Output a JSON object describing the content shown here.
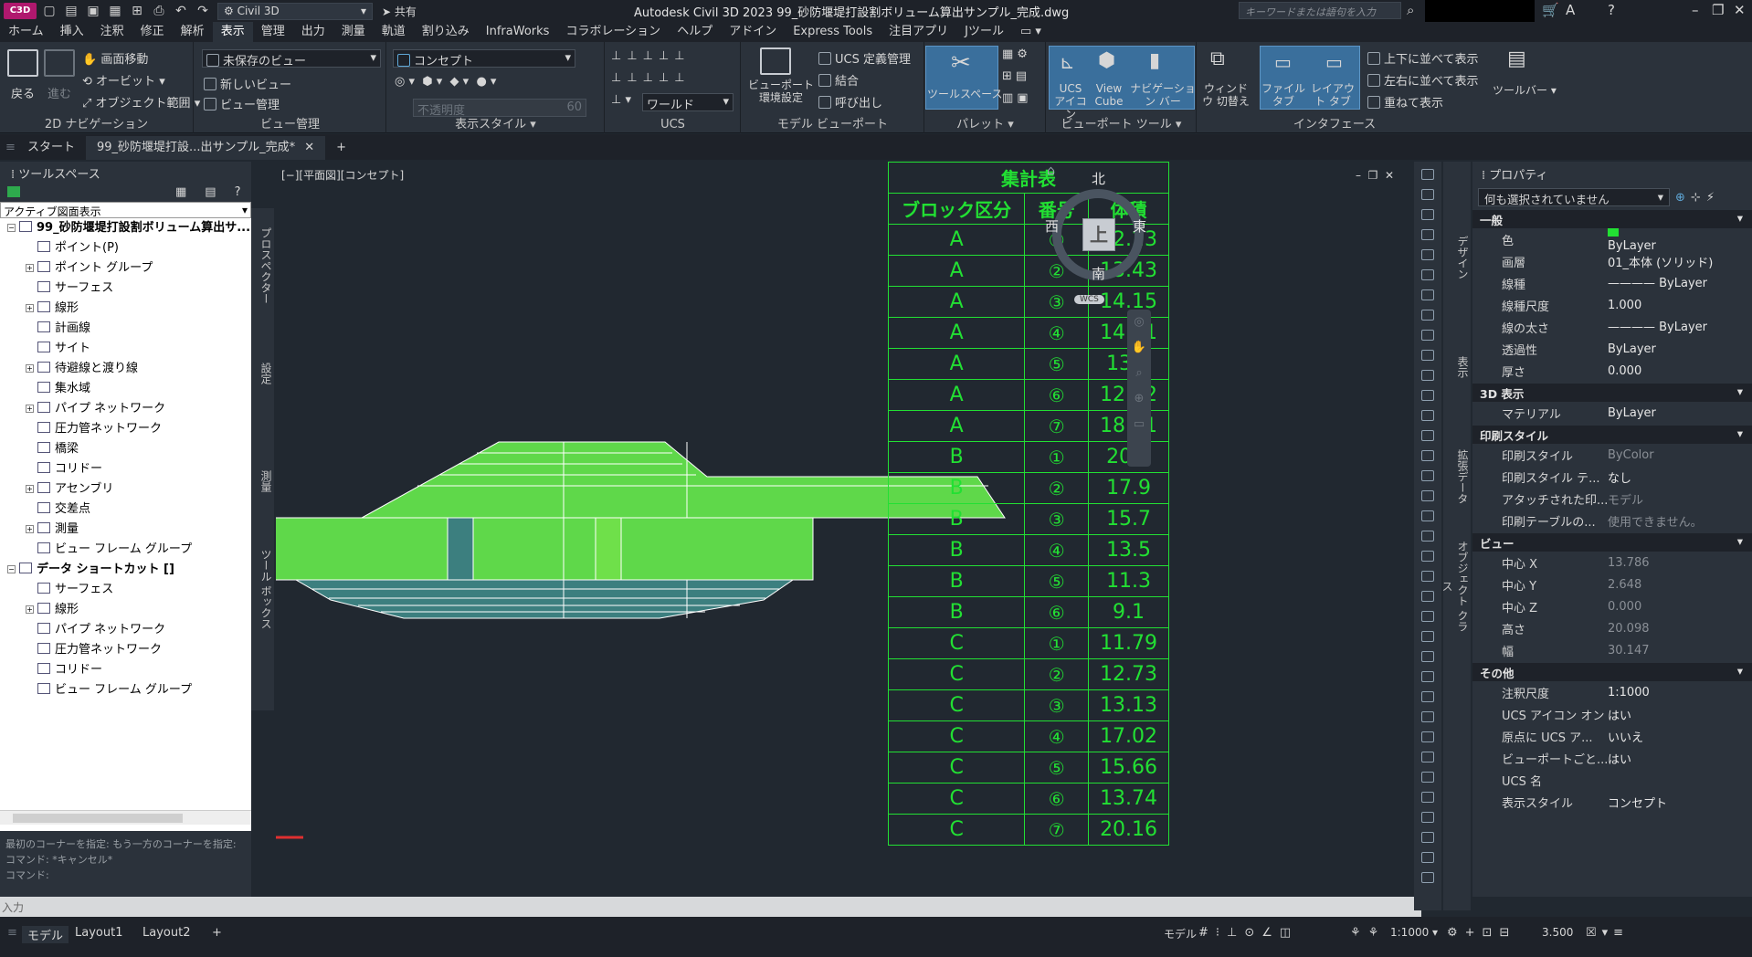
{
  "titlebar": {
    "logo": "C3D",
    "workspace": "Civil 3D",
    "share": "共有",
    "title": "Autodesk Civil 3D 2023    99_砂防堰堤打設割ボリューム算出サンプル_完成.dwg",
    "search_placeholder": "キーワードまたは語句を入力"
  },
  "menu": [
    "ホーム",
    "挿入",
    "注釈",
    "修正",
    "解析",
    "表示",
    "管理",
    "出力",
    "測量",
    "軌道",
    "割り込み",
    "InfraWorks",
    "コラボレーション",
    "ヘルプ",
    "アドイン",
    "Express Tools",
    "注目アプリ",
    "Jツール"
  ],
  "menu_active": "表示",
  "ribbon": {
    "nav2d": {
      "label": "2D ナビゲーション",
      "back": "戻る",
      "forward": "進む",
      "pan": "画面移動",
      "orbit": "オービット",
      "extents": "オブジェクト範囲"
    },
    "views": {
      "label": "ビュー管理",
      "unsaved": "未保存のビュー",
      "new": "新しいビュー",
      "manager": "ビュー管理"
    },
    "visual": {
      "label": "表示スタイル",
      "style": "コンセプト",
      "opacity": "不透明度",
      "opacity_val": "60"
    },
    "ucs": {
      "label": "UCS",
      "world": "ワールド"
    },
    "model": {
      "label": "モデル ビューポート",
      "vp": "ビューポート 環境設定",
      "ucsdef": "UCS 定義管理",
      "join": "結合",
      "restore": "呼び出し"
    },
    "palette": {
      "label": "パレット",
      "toolspace": "ツールスペース"
    },
    "vptools": {
      "label": "ビューポート ツール",
      "ucsicon": "UCS アイコン",
      "viewcube": "View Cube",
      "navbar": "ナビゲーション バー"
    },
    "iface": {
      "label": "インタフェース",
      "switch": "ウィンドウ 切替え",
      "filetab": "ファイル タブ",
      "layouttab": "レイアウト タブ",
      "vert": "上下に並べて表示",
      "horiz": "左右に並べて表示",
      "cascade": "重ねて表示",
      "toolbar": "ツールバー"
    }
  },
  "doctabs": {
    "start": "スタート",
    "file": "99_砂防堰堤打設...出サンプル_完成*"
  },
  "toolspace": {
    "title": "ツールスペース",
    "view": "アクティブ図面表示",
    "tree": [
      {
        "label": "99_砂防堰堤打設割ボリューム算出サ...",
        "lvl": 0,
        "ex": "-"
      },
      {
        "label": "ポイント(P)",
        "lvl": 1,
        "ex": ""
      },
      {
        "label": "ポイント グループ",
        "lvl": 1,
        "ex": "+"
      },
      {
        "label": "サーフェス",
        "lvl": 1,
        "ex": ""
      },
      {
        "label": "線形",
        "lvl": 1,
        "ex": "+"
      },
      {
        "label": "計画線",
        "lvl": 1,
        "ex": ""
      },
      {
        "label": "サイト",
        "lvl": 1,
        "ex": ""
      },
      {
        "label": "待避線と渡り線",
        "lvl": 1,
        "ex": "+"
      },
      {
        "label": "集水域",
        "lvl": 1,
        "ex": ""
      },
      {
        "label": "パイプ ネットワーク",
        "lvl": 1,
        "ex": "+"
      },
      {
        "label": "圧力管ネットワーク",
        "lvl": 1,
        "ex": ""
      },
      {
        "label": "橋梁",
        "lvl": 1,
        "ex": ""
      },
      {
        "label": "コリドー",
        "lvl": 1,
        "ex": ""
      },
      {
        "label": "アセンブリ",
        "lvl": 1,
        "ex": "+"
      },
      {
        "label": "交差点",
        "lvl": 1,
        "ex": ""
      },
      {
        "label": "測量",
        "lvl": 1,
        "ex": "+"
      },
      {
        "label": "ビュー フレーム グループ",
        "lvl": 1,
        "ex": ""
      },
      {
        "label": "データ ショートカット []",
        "lvl": 0,
        "ex": "-"
      },
      {
        "label": "サーフェス",
        "lvl": 1,
        "ex": ""
      },
      {
        "label": "線形",
        "lvl": 1,
        "ex": "+"
      },
      {
        "label": "パイプ ネットワーク",
        "lvl": 1,
        "ex": ""
      },
      {
        "label": "圧力管ネットワーク",
        "lvl": 1,
        "ex": ""
      },
      {
        "label": "コリドー",
        "lvl": 1,
        "ex": ""
      },
      {
        "label": "ビュー フレーム グループ",
        "lvl": 1,
        "ex": ""
      }
    ],
    "vtabs": [
      "プロスペクター",
      "設定",
      "測量",
      "ツール ボックス"
    ]
  },
  "command": {
    "line1": "最初のコーナーを指定: もう一方のコーナーを指定:",
    "line2": "コマンド: *キャンセル*",
    "line3": "コマンド:",
    "input": "入力"
  },
  "viewport": {
    "label": "[−][平面図][コンセプト]"
  },
  "viewcube": {
    "north": "北",
    "south": "南",
    "east": "東",
    "west": "西",
    "face": "上",
    "wcs": "WCS"
  },
  "table": {
    "title": "集計表",
    "h1": "ブロック区分",
    "h2": "番号",
    "h3": "体積",
    "rows": [
      [
        "A",
        "①",
        "12.23"
      ],
      [
        "A",
        "②",
        "13.43"
      ],
      [
        "A",
        "③",
        "14.15"
      ],
      [
        "A",
        "④",
        "14.21"
      ],
      [
        "A",
        "⑤",
        "13.6"
      ],
      [
        "A",
        "⑥",
        "12.32"
      ],
      [
        "A",
        "⑦",
        "18.61"
      ],
      [
        "B",
        "①",
        "20.1"
      ],
      [
        "B",
        "②",
        "17.9"
      ],
      [
        "B",
        "③",
        "15.7"
      ],
      [
        "B",
        "④",
        "13.5"
      ],
      [
        "B",
        "⑤",
        "11.3"
      ],
      [
        "B",
        "⑥",
        "9.1"
      ],
      [
        "C",
        "①",
        "11.79"
      ],
      [
        "C",
        "②",
        "12.73"
      ],
      [
        "C",
        "③",
        "13.13"
      ],
      [
        "C",
        "④",
        "17.02"
      ],
      [
        "C",
        "⑤",
        "15.66"
      ],
      [
        "C",
        "⑥",
        "13.74"
      ],
      [
        "C",
        "⑦",
        "20.16"
      ]
    ]
  },
  "palettetabs": [
    "デザイン",
    "表示",
    "拡張データ",
    "オブジェクト クラス"
  ],
  "props": {
    "title": "プロパティ",
    "selection": "何も選択されていません",
    "sections": [
      {
        "name": "一般",
        "rows": [
          [
            "色",
            "ByLayer"
          ],
          [
            "画層",
            "01_本体 (ソリッド)"
          ],
          [
            "線種",
            "———— ByLayer"
          ],
          [
            "線種尺度",
            "1.000"
          ],
          [
            "線の太さ",
            "———— ByLayer"
          ],
          [
            "透過性",
            "ByLayer"
          ],
          [
            "厚さ",
            "0.000"
          ]
        ]
      },
      {
        "name": "3D 表示",
        "rows": [
          [
            "マテリアル",
            "ByLayer"
          ]
        ]
      },
      {
        "name": "印刷スタイル",
        "rows": [
          [
            "印刷スタイル",
            "ByColor"
          ],
          [
            "印刷スタイル テ...",
            "なし"
          ],
          [
            "アタッチされた印...",
            "モデル"
          ],
          [
            "印刷テーブルの...",
            "使用できません。"
          ]
        ]
      },
      {
        "name": "ビュー",
        "rows": [
          [
            "中心 X",
            "13.786"
          ],
          [
            "中心 Y",
            "2.648"
          ],
          [
            "中心 Z",
            "0.000"
          ],
          [
            "高さ",
            "20.098"
          ],
          [
            "幅",
            "30.147"
          ]
        ]
      },
      {
        "name": "その他",
        "rows": [
          [
            "注釈尺度",
            "1:1000"
          ],
          [
            "UCS アイコン オン",
            "はい"
          ],
          [
            "原点に UCS ア...",
            "いいえ"
          ],
          [
            "ビューポートごと...",
            "はい"
          ],
          [
            "UCS 名",
            ""
          ],
          [
            "表示スタイル",
            "コンセプト"
          ]
        ]
      }
    ]
  },
  "status": {
    "model": "モデル",
    "layout1": "Layout1",
    "layout2": "Layout2",
    "add": "+",
    "mode": "モデル",
    "scale": "1:1000",
    "value": "3.500"
  },
  "colors": {
    "accent": "#3a6f9c",
    "green": "#22e033",
    "fill": "#5fd84a",
    "teal": "#3c7f7f"
  }
}
